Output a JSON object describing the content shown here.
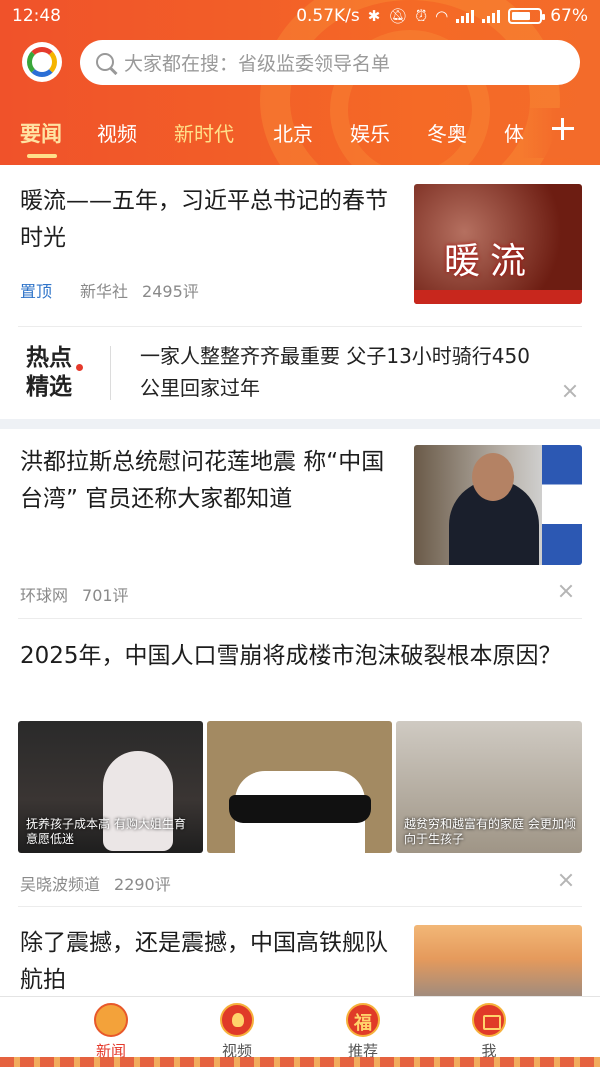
{
  "status_bar": {
    "time": "12:48",
    "network_speed": "0.57K/s",
    "battery_percent": "67%",
    "battery_level": 0.67
  },
  "header": {
    "search_placeholder": "大家都在搜：省级监委领导名单",
    "tabs": [
      {
        "label": "要闻",
        "active": true
      },
      {
        "label": "视频"
      },
      {
        "label": "新时代",
        "highlight": true
      },
      {
        "label": "北京"
      },
      {
        "label": "娱乐"
      },
      {
        "label": "冬奥"
      },
      {
        "label": "体"
      }
    ]
  },
  "feed": {
    "item1": {
      "title": "暖流——五年，习近平总书记的春节时光",
      "tag": "置顶",
      "source": "新华社",
      "comments": "2495评",
      "thumb_text": "暖流"
    },
    "hot": {
      "label": "热点精选",
      "text": "一家人整整齐齐最重要 父子13小时骑行450公里回家过年"
    },
    "item2": {
      "title": "洪都拉斯总统慰问花莲地震 称“中国台湾” 官员还称大家都知道",
      "source": "环球网",
      "comments": "701评"
    },
    "item3": {
      "title": "2025年，中国人口雪崩将成楼市泡沫破裂根本原因？",
      "source": "吴晓波频道",
      "comments": "2290评",
      "caption_left": "抚养孩子成本高 有购大姐生育意愿低迷",
      "caption_right": "越贫穷和越富有的家庭 会更加倾向于生孩子"
    },
    "item4": {
      "title": "除了震撼，还是震撼，中国高铁舰队航拍"
    }
  },
  "bottom_nav": [
    {
      "label": "新闻",
      "active": true
    },
    {
      "label": "视频"
    },
    {
      "label": "推荐"
    },
    {
      "label": "我"
    }
  ],
  "colors": {
    "header_orange": "#f25e28",
    "accent_red": "#e4392b",
    "tag_blue": "#2f74c9"
  }
}
